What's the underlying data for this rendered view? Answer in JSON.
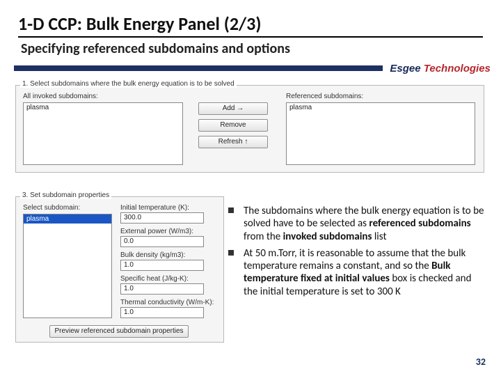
{
  "title": "1-D CCP: Bulk Energy Panel (2/3)",
  "subtitle": "Specifying referenced subdomains and options",
  "brand": {
    "name": "Esgee",
    "suffix": "Technologies"
  },
  "step1": {
    "title": "1. Select subdomains where the bulk energy equation is to be solved",
    "invoked_label": "All invoked subdomains:",
    "referenced_label": "Referenced subdomains:",
    "invoked_item": "plasma",
    "referenced_item": "plasma",
    "btn_add": "Add →",
    "btn_remove": "Remove",
    "btn_refresh": "Refresh ↑"
  },
  "step3": {
    "title": "3. Set subdomain properties",
    "select_label": "Select subdomain:",
    "select_item": "plasma",
    "fields": {
      "init_temp_label": "Initial temperature (K):",
      "init_temp_val": "300.0",
      "ext_power_label": "External power (W/m3):",
      "ext_power_val": "0.0",
      "bulk_density_label": "Bulk density (kg/m3):",
      "bulk_density_val": "1.0",
      "spec_heat_label": "Specific heat (J/kg-K):",
      "spec_heat_val": "1.0",
      "therm_cond_label": "Thermal conductivity (W/m-K):",
      "therm_cond_val": "1.0"
    },
    "preview_btn": "Preview referenced subdomain properties"
  },
  "bullets": {
    "b1_pre": "The subdomains where the bulk energy equation is to be solved have to be selected as ",
    "b1_bold1": "referenced subdomains",
    "b1_mid": "  from the ",
    "b1_bold2": "invoked subdomains",
    "b1_post": " list",
    "b2_pre": "At 50 m.Torr, it is reasonable to assume that the bulk temperature remains a constant, and so the ",
    "b2_bold": "Bulk temperature fixed at initial values",
    "b2_post": " box is checked and the initial temperature is set to 300 K"
  },
  "pagenum": "32"
}
